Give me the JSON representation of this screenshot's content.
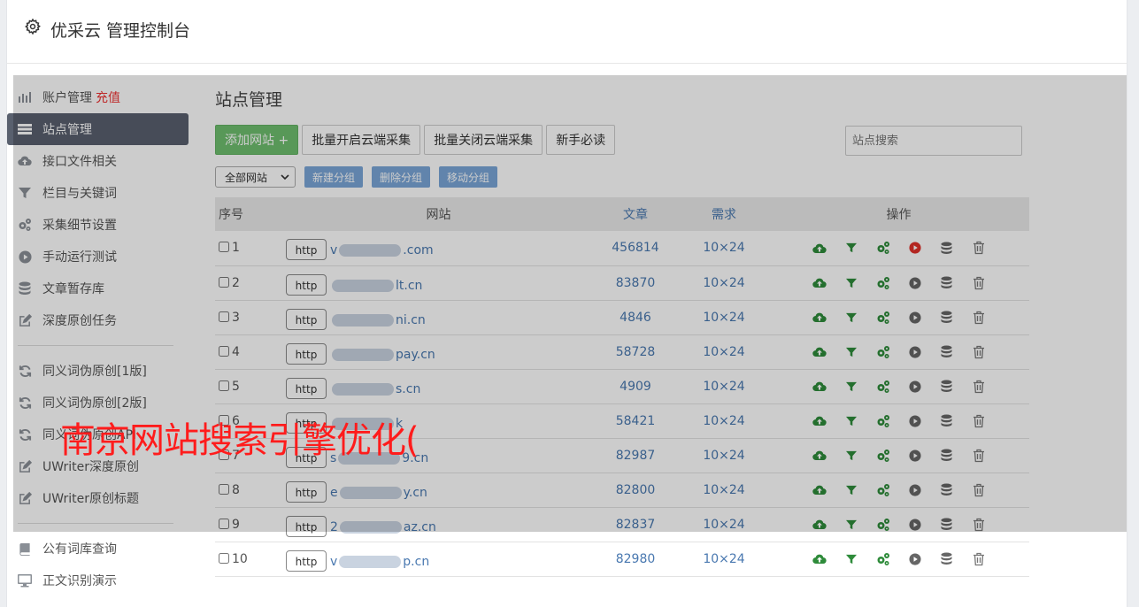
{
  "header": {
    "title": "优采云 管理控制台"
  },
  "sidebar": {
    "group1": [
      {
        "label": "账户管理",
        "extra": "充值",
        "icon": "bar-chart-icon"
      },
      {
        "label": "站点管理",
        "icon": "list-icon",
        "active": true
      },
      {
        "label": "接口文件相关",
        "icon": "cloud-upload-icon"
      },
      {
        "label": "栏目与关键词",
        "icon": "filter-icon"
      },
      {
        "label": "采集细节设置",
        "icon": "gears-icon"
      },
      {
        "label": "手动运行测试",
        "icon": "play-circle-icon"
      },
      {
        "label": "文章暂存库",
        "icon": "database-icon"
      },
      {
        "label": "深度原创任务",
        "icon": "edit-icon"
      }
    ],
    "group2": [
      {
        "label": "同义词伪原创[1版]",
        "icon": "refresh-icon"
      },
      {
        "label": "同义词伪原创[2版]",
        "icon": "refresh-icon"
      },
      {
        "label": "同义词伪原创API",
        "icon": "refresh-icon"
      },
      {
        "label": "UWriter深度原创",
        "icon": "edit-icon"
      },
      {
        "label": "UWriter原创标题",
        "icon": "edit-icon"
      }
    ],
    "group3": [
      {
        "label": "公有词库查询",
        "icon": "book-icon"
      },
      {
        "label": "正文识别演示",
        "icon": "monitor-icon"
      }
    ]
  },
  "main": {
    "title": "站点管理",
    "buttons": {
      "add_site": "添加网站 +",
      "batch_enable": "批量开启云端采集",
      "batch_disable": "批量关闭云端采集",
      "newbie": "新手必读"
    },
    "search_placeholder": "站点搜索",
    "filter_select": "全部网站",
    "group_buttons": {
      "new": "新建分组",
      "delete": "删除分组",
      "move": "移动分组"
    },
    "table": {
      "headers": {
        "no": "序号",
        "site": "网站",
        "articles": "文章",
        "demand": "需求",
        "ops": "操作"
      },
      "rows": [
        {
          "no": "1",
          "proto": "http",
          "pre": "v",
          "post": ".com",
          "articles": "456814",
          "demand": "10×24",
          "run_active": true
        },
        {
          "no": "2",
          "proto": "http",
          "pre": "",
          "post": "lt.cn",
          "articles": "83870",
          "demand": "10×24",
          "run_active": false
        },
        {
          "no": "3",
          "proto": "http",
          "pre": "",
          "post": "ni.cn",
          "articles": "4846",
          "demand": "10×24",
          "run_active": false
        },
        {
          "no": "4",
          "proto": "http",
          "pre": "",
          "post": "pay.cn",
          "articles": "58728",
          "demand": "10×24",
          "run_active": false
        },
        {
          "no": "5",
          "proto": "http",
          "pre": "",
          "post": "s.cn",
          "articles": "4909",
          "demand": "10×24",
          "run_active": false
        },
        {
          "no": "6",
          "proto": "http",
          "pre": "",
          "post": "k",
          "articles": "58421",
          "demand": "10×24",
          "run_active": false
        },
        {
          "no": "7",
          "proto": "http",
          "pre": "s",
          "post": "9.cn",
          "articles": "82987",
          "demand": "10×24",
          "run_active": false
        },
        {
          "no": "8",
          "proto": "http",
          "pre": "e",
          "post": "y.cn",
          "articles": "82800",
          "demand": "10×24",
          "run_active": false
        },
        {
          "no": "9",
          "proto": "http",
          "pre": "2",
          "post": "az.cn",
          "articles": "82837",
          "demand": "10×24",
          "run_active": false
        },
        {
          "no": "10",
          "proto": "http",
          "pre": "v",
          "post": "p.cn",
          "articles": "82980",
          "demand": "10×24",
          "run_active": false
        }
      ]
    }
  },
  "watermark": "南京网站搜索引擎优化(",
  "colors": {
    "active_nav": "#59606e",
    "green": "#6fbf6f",
    "blue_btn": "#7aa6d8",
    "link": "#4978b0",
    "recharge": "#ee3333",
    "run_active": "#e0302a",
    "watermark": "#ff1c1c"
  }
}
